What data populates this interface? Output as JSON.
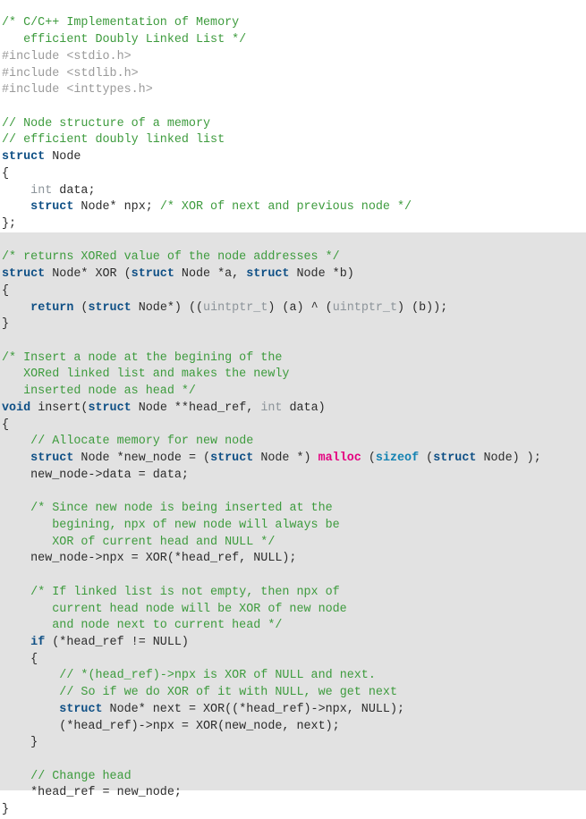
{
  "document": {
    "kind": "source-code-listing",
    "language": "C/C++",
    "title": "C/C++ Implementation of Memory efficient Doubly Linked List",
    "theme": {
      "page_background": "#ffffff",
      "highlight_background": "#e2e2e2",
      "highlight_start_line": 14,
      "default_text": "#2b2b2b",
      "comment": "#3d9b3d",
      "preprocessor": "#9a9a9a",
      "keyword": "#0e4f85",
      "type": "#8c949a",
      "builtin_operator": "#1382b2",
      "library_function": "#e4007f"
    }
  },
  "lines": [
    {
      "n": 1,
      "shaded": false,
      "tokens": [
        {
          "t": "/* C/C++ Implementation of Memory",
          "c": "cm"
        }
      ]
    },
    {
      "n": 2,
      "shaded": false,
      "tokens": [
        {
          "t": "   efficient Doubly Linked List */",
          "c": "cm"
        }
      ]
    },
    {
      "n": 3,
      "shaded": false,
      "tokens": [
        {
          "t": "#include <stdio.h>",
          "c": "pp"
        }
      ]
    },
    {
      "n": 4,
      "shaded": false,
      "tokens": [
        {
          "t": "#include <stdlib.h>",
          "c": "pp"
        }
      ]
    },
    {
      "n": 5,
      "shaded": false,
      "tokens": [
        {
          "t": "#include <inttypes.h>",
          "c": "pp"
        }
      ]
    },
    {
      "n": 6,
      "shaded": false,
      "tokens": []
    },
    {
      "n": 7,
      "shaded": false,
      "tokens": [
        {
          "t": "// Node structure of a memory",
          "c": "cm"
        }
      ]
    },
    {
      "n": 8,
      "shaded": false,
      "tokens": [
        {
          "t": "// efficient doubly linked list",
          "c": "cm"
        }
      ]
    },
    {
      "n": 9,
      "shaded": false,
      "tokens": [
        {
          "t": "struct",
          "c": "kw"
        },
        {
          "t": " Node",
          "c": "pl"
        }
      ]
    },
    {
      "n": 10,
      "shaded": false,
      "tokens": [
        {
          "t": "{",
          "c": "pl"
        }
      ]
    },
    {
      "n": 11,
      "shaded": false,
      "tokens": [
        {
          "t": "    ",
          "c": "pl"
        },
        {
          "t": "int",
          "c": "ty"
        },
        {
          "t": " data;",
          "c": "pl"
        }
      ]
    },
    {
      "n": 12,
      "shaded": false,
      "tokens": [
        {
          "t": "    ",
          "c": "pl"
        },
        {
          "t": "struct",
          "c": "kw"
        },
        {
          "t": " Node* npx; ",
          "c": "pl"
        },
        {
          "t": "/* XOR of next and previous node */",
          "c": "cm"
        }
      ]
    },
    {
      "n": 13,
      "shaded": false,
      "tokens": [
        {
          "t": "};",
          "c": "pl"
        }
      ]
    },
    {
      "n": 14,
      "shaded": true,
      "tokens": []
    },
    {
      "n": 15,
      "shaded": true,
      "tokens": [
        {
          "t": "/* returns XORed value of the node addresses */",
          "c": "cm"
        }
      ]
    },
    {
      "n": 16,
      "shaded": true,
      "tokens": [
        {
          "t": "struct",
          "c": "kw"
        },
        {
          "t": " Node* XOR (",
          "c": "pl"
        },
        {
          "t": "struct",
          "c": "kw"
        },
        {
          "t": " Node *a, ",
          "c": "pl"
        },
        {
          "t": "struct",
          "c": "kw"
        },
        {
          "t": " Node *b)",
          "c": "pl"
        }
      ]
    },
    {
      "n": 17,
      "shaded": true,
      "tokens": [
        {
          "t": "{",
          "c": "pl"
        }
      ]
    },
    {
      "n": 18,
      "shaded": true,
      "tokens": [
        {
          "t": "    ",
          "c": "pl"
        },
        {
          "t": "return",
          "c": "kw"
        },
        {
          "t": " (",
          "c": "pl"
        },
        {
          "t": "struct",
          "c": "kw"
        },
        {
          "t": " Node*) ((",
          "c": "pl"
        },
        {
          "t": "uintptr_t",
          "c": "ty"
        },
        {
          "t": ") (a) ^ (",
          "c": "pl"
        },
        {
          "t": "uintptr_t",
          "c": "ty"
        },
        {
          "t": ") (b));",
          "c": "pl"
        }
      ]
    },
    {
      "n": 19,
      "shaded": true,
      "tokens": [
        {
          "t": "}",
          "c": "pl"
        }
      ]
    },
    {
      "n": 20,
      "shaded": true,
      "tokens": []
    },
    {
      "n": 21,
      "shaded": true,
      "tokens": [
        {
          "t": "/* Insert a node at the begining of the",
          "c": "cm"
        }
      ]
    },
    {
      "n": 22,
      "shaded": true,
      "tokens": [
        {
          "t": "   XORed linked list and makes the newly",
          "c": "cm"
        }
      ]
    },
    {
      "n": 23,
      "shaded": true,
      "tokens": [
        {
          "t": "   inserted node as head */",
          "c": "cm"
        }
      ]
    },
    {
      "n": 24,
      "shaded": true,
      "tokens": [
        {
          "t": "void",
          "c": "kw"
        },
        {
          "t": " insert(",
          "c": "pl"
        },
        {
          "t": "struct",
          "c": "kw"
        },
        {
          "t": " Node **head_ref, ",
          "c": "pl"
        },
        {
          "t": "int",
          "c": "ty"
        },
        {
          "t": " data)",
          "c": "pl"
        }
      ]
    },
    {
      "n": 25,
      "shaded": true,
      "tokens": [
        {
          "t": "{",
          "c": "pl"
        }
      ]
    },
    {
      "n": 26,
      "shaded": true,
      "tokens": [
        {
          "t": "    ",
          "c": "pl"
        },
        {
          "t": "// Allocate memory for new node",
          "c": "cm"
        }
      ]
    },
    {
      "n": 27,
      "shaded": true,
      "tokens": [
        {
          "t": "    ",
          "c": "pl"
        },
        {
          "t": "struct",
          "c": "kw"
        },
        {
          "t": " Node *new_node = (",
          "c": "pl"
        },
        {
          "t": "struct",
          "c": "kw"
        },
        {
          "t": " Node *) ",
          "c": "pl"
        },
        {
          "t": "malloc",
          "c": "fn"
        },
        {
          "t": " (",
          "c": "pl"
        },
        {
          "t": "sizeof",
          "c": "szf"
        },
        {
          "t": " (",
          "c": "pl"
        },
        {
          "t": "struct",
          "c": "kw"
        },
        {
          "t": " Node) );",
          "c": "pl"
        }
      ]
    },
    {
      "n": 28,
      "shaded": true,
      "tokens": [
        {
          "t": "    new_node->data = data;",
          "c": "pl"
        }
      ]
    },
    {
      "n": 29,
      "shaded": true,
      "tokens": []
    },
    {
      "n": 30,
      "shaded": true,
      "tokens": [
        {
          "t": "    ",
          "c": "pl"
        },
        {
          "t": "/* Since new node is being inserted at the",
          "c": "cm"
        }
      ]
    },
    {
      "n": 31,
      "shaded": true,
      "tokens": [
        {
          "t": "       begining, npx of new node will always be",
          "c": "cm"
        }
      ]
    },
    {
      "n": 32,
      "shaded": true,
      "tokens": [
        {
          "t": "       XOR of current head and NULL */",
          "c": "cm"
        }
      ]
    },
    {
      "n": 33,
      "shaded": true,
      "tokens": [
        {
          "t": "    new_node->npx = XOR(*head_ref, NULL);",
          "c": "pl"
        }
      ]
    },
    {
      "n": 34,
      "shaded": true,
      "tokens": []
    },
    {
      "n": 35,
      "shaded": true,
      "tokens": [
        {
          "t": "    ",
          "c": "pl"
        },
        {
          "t": "/* If linked list is not empty, then npx of",
          "c": "cm"
        }
      ]
    },
    {
      "n": 36,
      "shaded": true,
      "tokens": [
        {
          "t": "       current head node will be XOR of new node",
          "c": "cm"
        }
      ]
    },
    {
      "n": 37,
      "shaded": true,
      "tokens": [
        {
          "t": "       and node next to current head */",
          "c": "cm"
        }
      ]
    },
    {
      "n": 38,
      "shaded": true,
      "tokens": [
        {
          "t": "    ",
          "c": "pl"
        },
        {
          "t": "if",
          "c": "kw"
        },
        {
          "t": " (*head_ref != NULL)",
          "c": "pl"
        }
      ]
    },
    {
      "n": 39,
      "shaded": true,
      "tokens": [
        {
          "t": "    {",
          "c": "pl"
        }
      ]
    },
    {
      "n": 40,
      "shaded": true,
      "tokens": [
        {
          "t": "        ",
          "c": "pl"
        },
        {
          "t": "// *(head_ref)->npx is XOR of NULL and next.",
          "c": "cm"
        }
      ]
    },
    {
      "n": 41,
      "shaded": true,
      "tokens": [
        {
          "t": "        ",
          "c": "pl"
        },
        {
          "t": "// So if we do XOR of it with NULL, we get next",
          "c": "cm"
        }
      ]
    },
    {
      "n": 42,
      "shaded": true,
      "tokens": [
        {
          "t": "        ",
          "c": "pl"
        },
        {
          "t": "struct",
          "c": "kw"
        },
        {
          "t": " Node* next = XOR((*head_ref)->npx, NULL);",
          "c": "pl"
        }
      ]
    },
    {
      "n": 43,
      "shaded": true,
      "tokens": [
        {
          "t": "        (*head_ref)->npx = XOR(new_node, next);",
          "c": "pl"
        }
      ]
    },
    {
      "n": 44,
      "shaded": true,
      "tokens": [
        {
          "t": "    }",
          "c": "pl"
        }
      ]
    },
    {
      "n": 45,
      "shaded": true,
      "tokens": []
    },
    {
      "n": 46,
      "shaded": true,
      "tokens": [
        {
          "t": "    ",
          "c": "pl"
        },
        {
          "t": "// Change head",
          "c": "cm"
        }
      ]
    },
    {
      "n": 47,
      "shaded": true,
      "tokens": [
        {
          "t": "    *head_ref = new_node;",
          "c": "pl"
        }
      ]
    },
    {
      "n": 48,
      "shaded": true,
      "tokens": [
        {
          "t": "}",
          "c": "pl"
        }
      ]
    }
  ]
}
